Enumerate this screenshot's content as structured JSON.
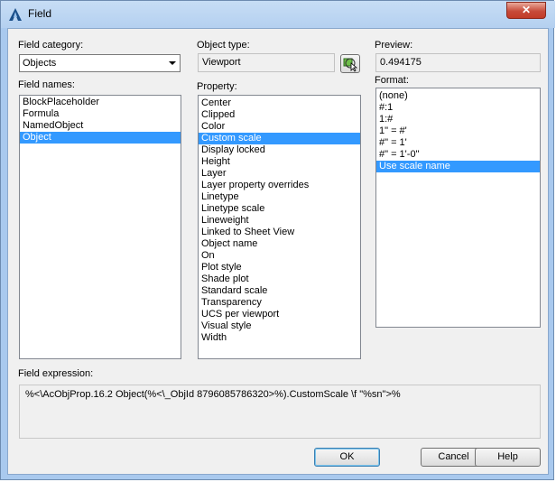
{
  "window": {
    "title": "Field",
    "close_label": "✕",
    "accent_color": "#3399ff"
  },
  "field_category": {
    "label": "Field category:",
    "value": "Objects"
  },
  "object_type": {
    "label": "Object type:",
    "value": "Viewport",
    "pick_icon": "select-object-icon"
  },
  "preview": {
    "label": "Preview:",
    "value": "0.494175"
  },
  "field_names": {
    "label": "Field names:",
    "items": [
      {
        "label": "BlockPlaceholder",
        "selected": false
      },
      {
        "label": "Formula",
        "selected": false
      },
      {
        "label": "NamedObject",
        "selected": false
      },
      {
        "label": "Object",
        "selected": true
      }
    ]
  },
  "property": {
    "label": "Property:",
    "items": [
      {
        "label": "Center",
        "selected": false
      },
      {
        "label": "Clipped",
        "selected": false
      },
      {
        "label": "Color",
        "selected": false
      },
      {
        "label": "Custom scale",
        "selected": true
      },
      {
        "label": "Display locked",
        "selected": false
      },
      {
        "label": "Height",
        "selected": false
      },
      {
        "label": "Layer",
        "selected": false
      },
      {
        "label": "Layer property overrides",
        "selected": false
      },
      {
        "label": "Linetype",
        "selected": false
      },
      {
        "label": "Linetype scale",
        "selected": false
      },
      {
        "label": "Lineweight",
        "selected": false
      },
      {
        "label": "Linked to Sheet View",
        "selected": false
      },
      {
        "label": "Object name",
        "selected": false
      },
      {
        "label": "On",
        "selected": false
      },
      {
        "label": "Plot style",
        "selected": false
      },
      {
        "label": "Shade plot",
        "selected": false
      },
      {
        "label": "Standard scale",
        "selected": false
      },
      {
        "label": "Transparency",
        "selected": false
      },
      {
        "label": "UCS per viewport",
        "selected": false
      },
      {
        "label": "Visual style",
        "selected": false
      },
      {
        "label": "Width",
        "selected": false
      }
    ]
  },
  "format": {
    "label": "Format:",
    "items": [
      {
        "label": "(none)",
        "selected": false
      },
      {
        "label": "#:1",
        "selected": false
      },
      {
        "label": "1:#",
        "selected": false
      },
      {
        "label": "1\" = #'",
        "selected": false
      },
      {
        "label": "#\" = 1'",
        "selected": false
      },
      {
        "label": "#\" = 1'-0\"",
        "selected": false
      },
      {
        "label": "Use scale name",
        "selected": true
      }
    ]
  },
  "field_expression": {
    "label": "Field expression:",
    "value": "%<\\AcObjProp.16.2 Object(%<\\_ObjId 8796085786320>%).CustomScale \\f \"%sn\">%"
  },
  "buttons": {
    "ok": "OK",
    "cancel": "Cancel",
    "help": "Help"
  }
}
